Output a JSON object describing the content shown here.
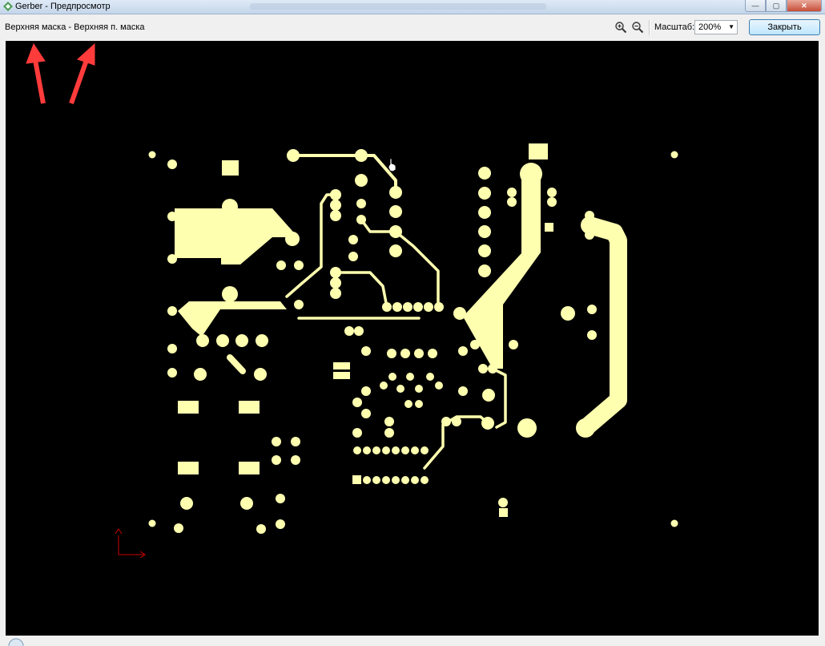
{
  "window": {
    "title": "Gerber - Предпросмотр",
    "icon": "gerber-app-icon"
  },
  "toolbar": {
    "layer_label": "Верхняя маска - Верхняя п. маска",
    "zoom_in_icon": "zoom-in-icon",
    "zoom_out_icon": "zoom-out-icon",
    "scale_label": "Масштаб:",
    "scale_value": "200%",
    "close_label": "Закрыть"
  },
  "colors": {
    "canvas_bg": "#000000",
    "pcb_copper": "#ffffb0",
    "annotation_arrow": "#ff3b3b",
    "origin_marker": "#cc0000"
  },
  "annotations": {
    "arrows": 2,
    "arrow_icon": "red-arrow-icon"
  }
}
